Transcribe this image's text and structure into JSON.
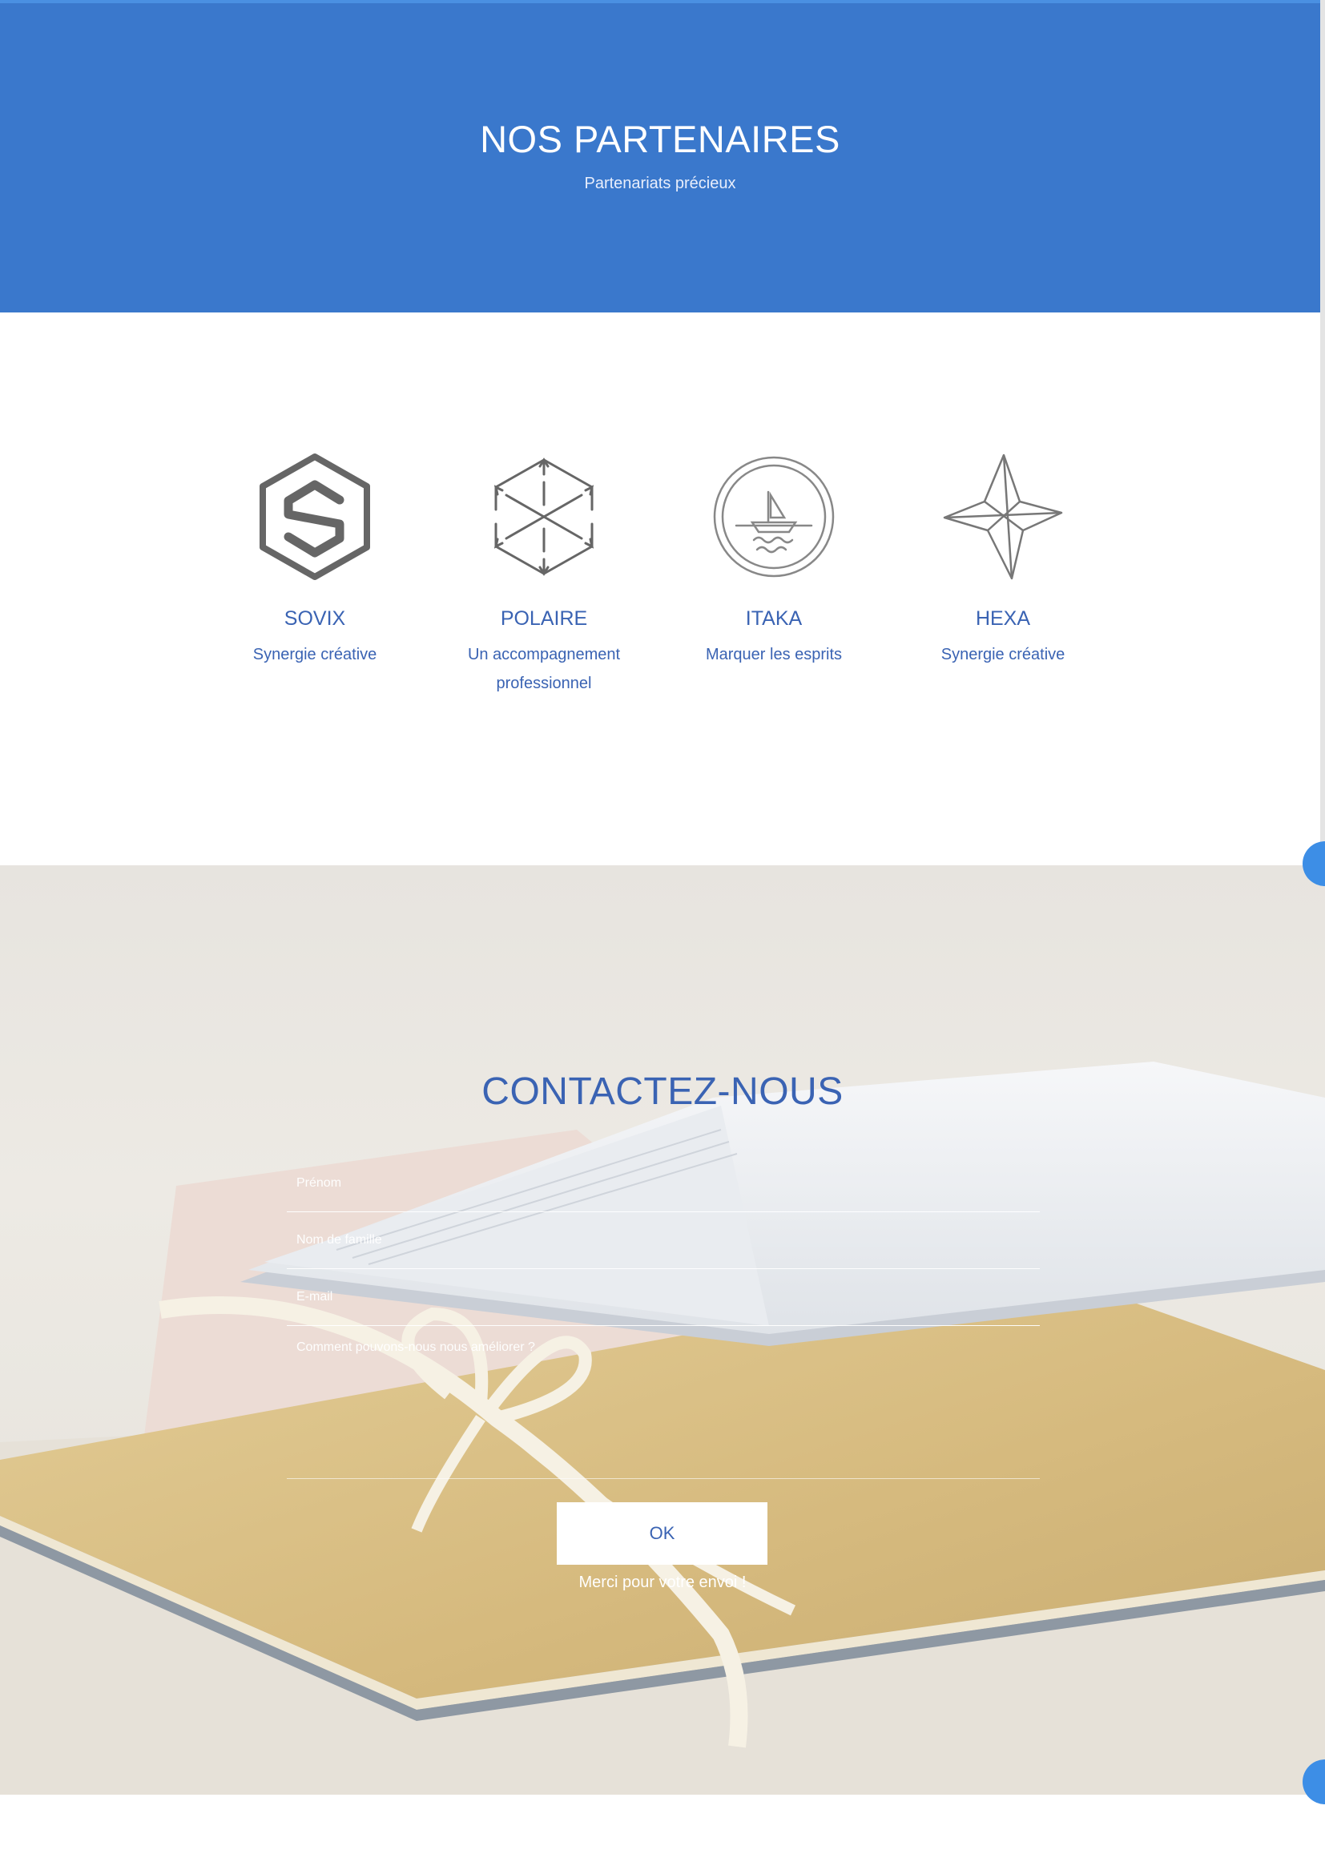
{
  "hero": {
    "title": "NOS PARTENAIRES",
    "subtitle": "Partenariats précieux",
    "background_color": "#3a78cc"
  },
  "partners": [
    {
      "name": "SOVIX",
      "tagline": "Synergie créative",
      "icon": "sovix-hexagon-s-logo"
    },
    {
      "name": "POLAIRE",
      "tagline": "Un accompagnement professionnel",
      "icon": "polaire-cube-logo"
    },
    {
      "name": "ITAKA",
      "tagline": "Marquer les esprits",
      "icon": "itaka-boat-circle-logo"
    },
    {
      "name": "HEXA",
      "tagline": "Synergie créative",
      "icon": "hexa-star-logo"
    }
  ],
  "contact": {
    "title": "CONTACTEZ-NOUS",
    "fields": {
      "first_name": {
        "placeholder": "Prénom",
        "value": ""
      },
      "last_name": {
        "placeholder": "Nom de famille",
        "value": ""
      },
      "email": {
        "placeholder": "E-mail",
        "value": ""
      },
      "message": {
        "placeholder": "Comment pouvons-nous nous améliorer ?",
        "value": ""
      }
    },
    "submit_label": "OK",
    "thanks_message": "Merci pour votre envoi !",
    "background_image": "envelopes-with-ribbon-photo"
  },
  "colors": {
    "accent": "#3a78cc",
    "heading_text": "#3a63b3",
    "side_dot": "#3d8ee6"
  }
}
